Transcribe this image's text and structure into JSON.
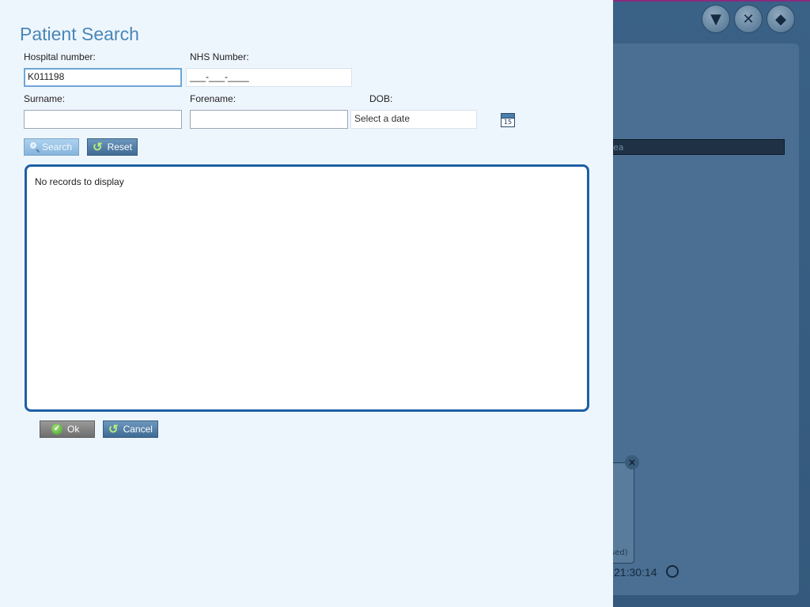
{
  "dialog": {
    "title": "Patient Search",
    "labels": {
      "hospital_number": "Hospital number:",
      "nhs_number": "NHS Number:",
      "surname": "Surname:",
      "forename": "Forename:",
      "dob": "DOB:"
    },
    "fields": {
      "hospital_number_value": "K011198",
      "nhs_number_value": "___-___-____",
      "surname_value": "",
      "forename_value": "",
      "dob_placeholder": "Select a date",
      "calendar_day": "15"
    },
    "buttons": {
      "search": "Search",
      "reset": "Reset",
      "ok": "Ok",
      "cancel": "Cancel"
    },
    "results": {
      "empty_message": "No records to display"
    }
  },
  "background": {
    "time_text": "21:30:14",
    "card_text": "sed)",
    "dark_bar_text": "ea",
    "toolbar_icons": [
      "filter-icon",
      "close-icon",
      "erase-icon"
    ]
  },
  "colors": {
    "dialog_bg": "#eef6fd",
    "title": "#4a86b8",
    "grid_border": "#1d5fa5",
    "app_bg": "#3a6186"
  }
}
